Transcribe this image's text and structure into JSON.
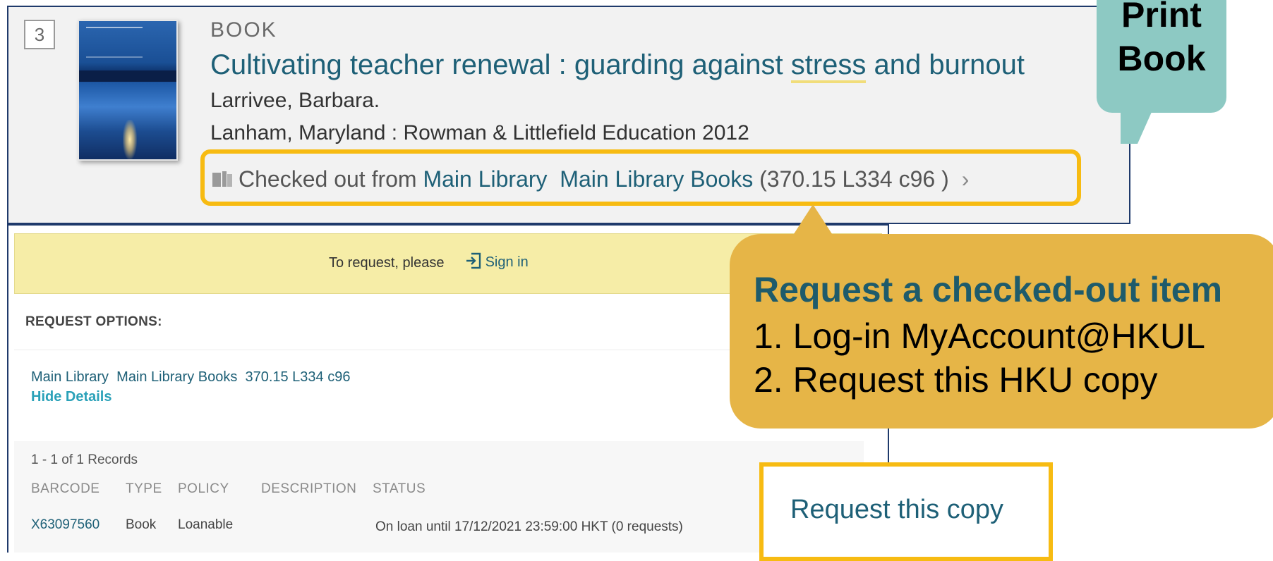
{
  "result": {
    "row_number": "3",
    "material_type": "BOOK",
    "title_before": "Cultivating teacher renewal : guarding against ",
    "title_highlight": "stress",
    "title_after": " and burnout",
    "author": "Larrivee, Barbara.",
    "publication": "Lanham, Maryland : Rowman & Littlefield Education 2012",
    "availability": {
      "icon": "book-icon",
      "status_text": "Checked out from ",
      "library": "Main Library",
      "location": "Main Library Books",
      "call_number": "(370.15 L334 c96 )",
      "chevron": "›"
    }
  },
  "request": {
    "prompt_text": "To request, please",
    "signin_label": "Sign in",
    "options_heading": "REQUEST OPTIONS:",
    "holding": "Main Library  Main Library Books  370.15 L334 c96",
    "hide_details": "Hide Details",
    "records_count": "1 - 1 of 1 Records",
    "columns": [
      "BARCODE",
      "TYPE",
      "POLICY",
      "DESCRIPTION",
      "STATUS"
    ],
    "item": {
      "barcode": "X63097560",
      "type": "Book",
      "policy": "Loanable",
      "description": "",
      "status": "On loan until 17/12/2021 23:59:00 HKT (0 requests)"
    },
    "request_copy_label": "Request this copy"
  },
  "callouts": {
    "print_book_line1": "Print",
    "print_book_line2": "Book",
    "request_heading": "Request a checked-out item",
    "request_step1": "1. Log-in MyAccount@HKUL",
    "request_step2": "2. Request this HKU copy"
  },
  "colors": {
    "link": "#1e6077",
    "highlight_box": "#f7bb12",
    "print_bubble": "#8dc9c3",
    "request_bubble": "#e6b547",
    "signin_bar": "#f6eda7"
  }
}
